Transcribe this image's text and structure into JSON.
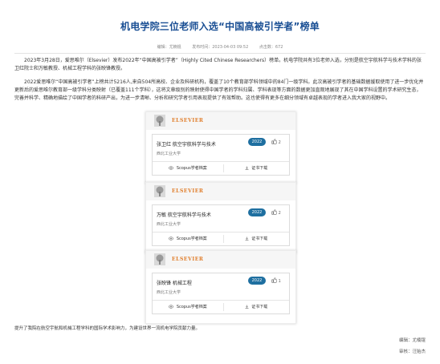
{
  "article": {
    "title": "机电学院三位老师入选“中国高被引学者”榜单",
    "meta": {
      "editor": "编辑：尤楠锟",
      "date": "发布时间：2023-04-03 09:52",
      "views": "点击数：672"
    },
    "p1": "2023年3月28日，爱思唯尔（Elsevier）发布2022年“中国高被引学者”（Highly Cited Chinese Researchers）榜单。机电学院共有3位老师入选，分别是航空宇航科学与技术学科的张卫红院士和万敏教授、机械工程学科的张映锋教授。",
    "p2": "2022爱思唯尔“中国高被引学者”上榜共计5216人,来自504所高校、企业及科研机构，覆盖了10个教育部学科领域中的84门一级学科。此次高被引学者的基础数据援取使用了进一步优化并更新后的爱思唯尔教育部一级学科分类映射（已覆盖111个学科），这将文章级别的映射使得中国学者的学科归属、学科表现等方面的数据更加直观地展现了其在中国学科设置的学术研究生态，完善并科学、精确地描绘了中国学者的科研产出，为进一步清晰、分析和研究学者引用表现提供了有效帮助。这也使得有更多在细分领域有卓越表现的学者进入我大家的视野中。",
    "closing": "提升了我院在航空宇航和机械工程学科的国际学术影响力，为建设世界一流机电学院贡献力量。",
    "footer_editor": "编辑：尤楠锟",
    "footer_reviewer": "审核：汪贻杰"
  },
  "elsevier_brand": "ELSEVIER",
  "cards": [
    {
      "name": "张卫红   航空宇航科学与技术",
      "affiliation": "西北工业大学",
      "year": "2022",
      "likes": "2",
      "profile_btn": "Scopus学者档案",
      "cert_btn": "证书下载"
    },
    {
      "name": "万敏   航空宇航科学与技术",
      "affiliation": "西北工业大学",
      "year": "2022",
      "likes": "2",
      "profile_btn": "Scopus学者档案",
      "cert_btn": "证书下载"
    },
    {
      "name": "张映锋   机械工程",
      "affiliation": "西北工业大学",
      "year": "2022",
      "likes": "1",
      "profile_btn": "Scopus学者档案",
      "cert_btn": "证书下载"
    }
  ],
  "colors": {
    "title": "#1a4f94",
    "badge": "#1e6fa0",
    "brand": "#e07d2a"
  }
}
